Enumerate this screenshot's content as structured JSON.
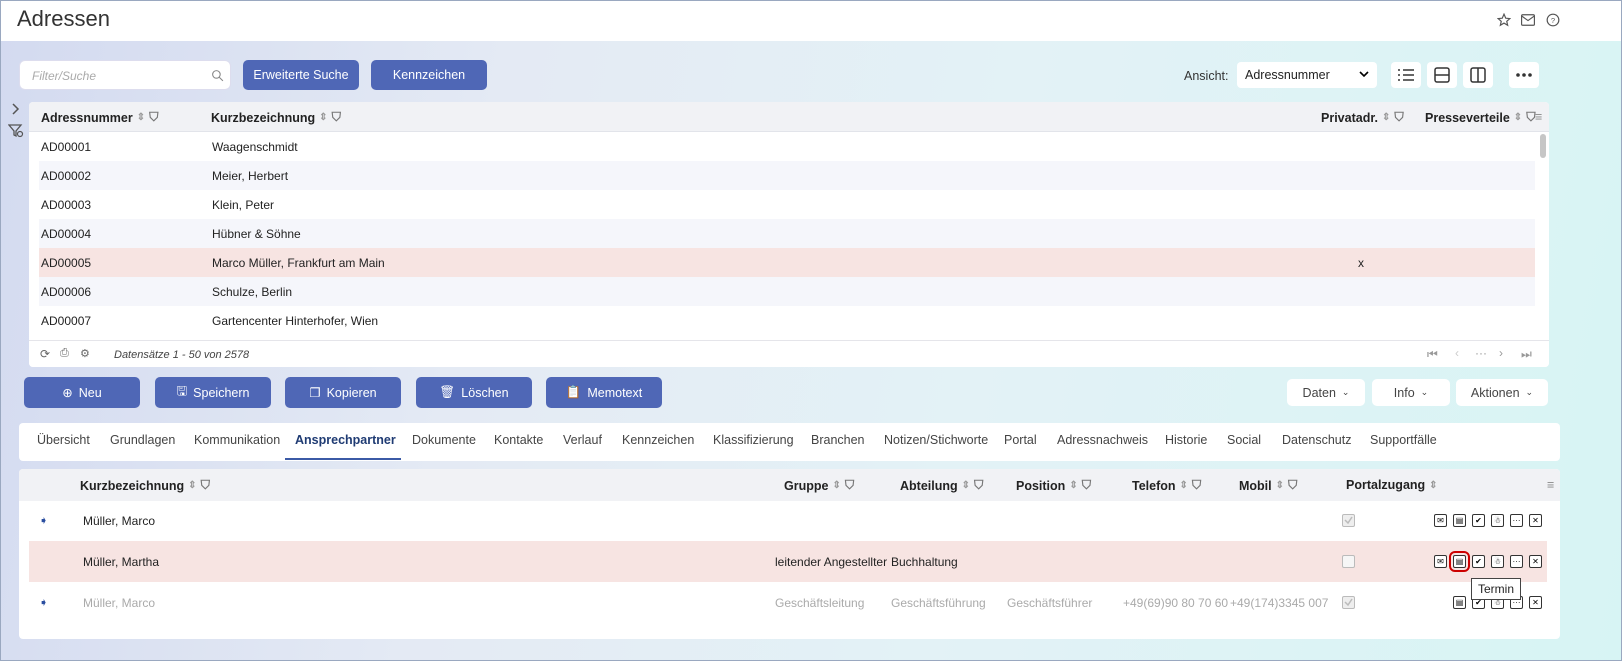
{
  "header": {
    "title": "Adressen"
  },
  "toolbar": {
    "search_placeholder": "Filter/Suche",
    "advanced_search": "Erweiterte Suche",
    "flags": "Kennzeichen",
    "view_label": "Ansicht:",
    "view_value": "Adressnummer"
  },
  "grid": {
    "columns": [
      "Adressnummer",
      "Kurzbezeichnung",
      "Privatadr.",
      "Presseverteile"
    ],
    "rows": [
      {
        "nr": "AD00001",
        "name": "Waagenschmidt",
        "priv": ""
      },
      {
        "nr": "AD00002",
        "name": "Meier, Herbert",
        "priv": ""
      },
      {
        "nr": "AD00003",
        "name": "Klein, Peter",
        "priv": ""
      },
      {
        "nr": "AD00004",
        "name": "Hübner & Söhne",
        "priv": ""
      },
      {
        "nr": "AD00005",
        "name": "Marco Müller, Frankfurt am Main",
        "priv": "x"
      },
      {
        "nr": "AD00006",
        "name": "Schulze, Berlin",
        "priv": ""
      },
      {
        "nr": "AD00007",
        "name": "Gartencenter Hinterhofer, Wien",
        "priv": ""
      }
    ],
    "footer": "Datensätze 1 - 50 von 2578"
  },
  "actions": {
    "new": "Neu",
    "save": "Speichern",
    "copy": "Kopieren",
    "delete": "Löschen",
    "memo": "Memotext",
    "data": "Daten",
    "info": "Info",
    "actions": "Aktionen"
  },
  "tabs": [
    "Übersicht",
    "Grundlagen",
    "Kommunikation",
    "Ansprechpartner",
    "Dokumente",
    "Kontakte",
    "Verlauf",
    "Kennzeichen",
    "Klassifizierung",
    "Branchen",
    "Notizen/Stichworte",
    "Portal",
    "Adressnachweis",
    "Historie",
    "Social",
    "Datenschutz",
    "Supportfälle"
  ],
  "contacts": {
    "columns": [
      "Kurzbezeichnung",
      "Gruppe",
      "Abteilung",
      "Position",
      "Telefon",
      "Mobil",
      "Portalzugang"
    ],
    "rows": [
      {
        "name": "Müller, Marco",
        "group": "",
        "dept": "",
        "pos": "",
        "tel": "",
        "mob": ""
      },
      {
        "name": "Müller, Martha",
        "group": "leitender Angestellter",
        "dept": "Buchhaltung",
        "pos": "",
        "tel": "",
        "mob": ""
      },
      {
        "name": "Müller, Marco",
        "group": "Geschäftsleitung",
        "dept": "Geschäftsführung",
        "pos": "Geschäftsführer",
        "tel": "+49(69)90 80 70 60",
        "mob": "+49(174)3345 007"
      }
    ],
    "tooltip": "Termin"
  },
  "colors": {
    "primary": "#4f67b6",
    "selected_row": "#f7e4e2",
    "highlight": "#cc0000"
  }
}
